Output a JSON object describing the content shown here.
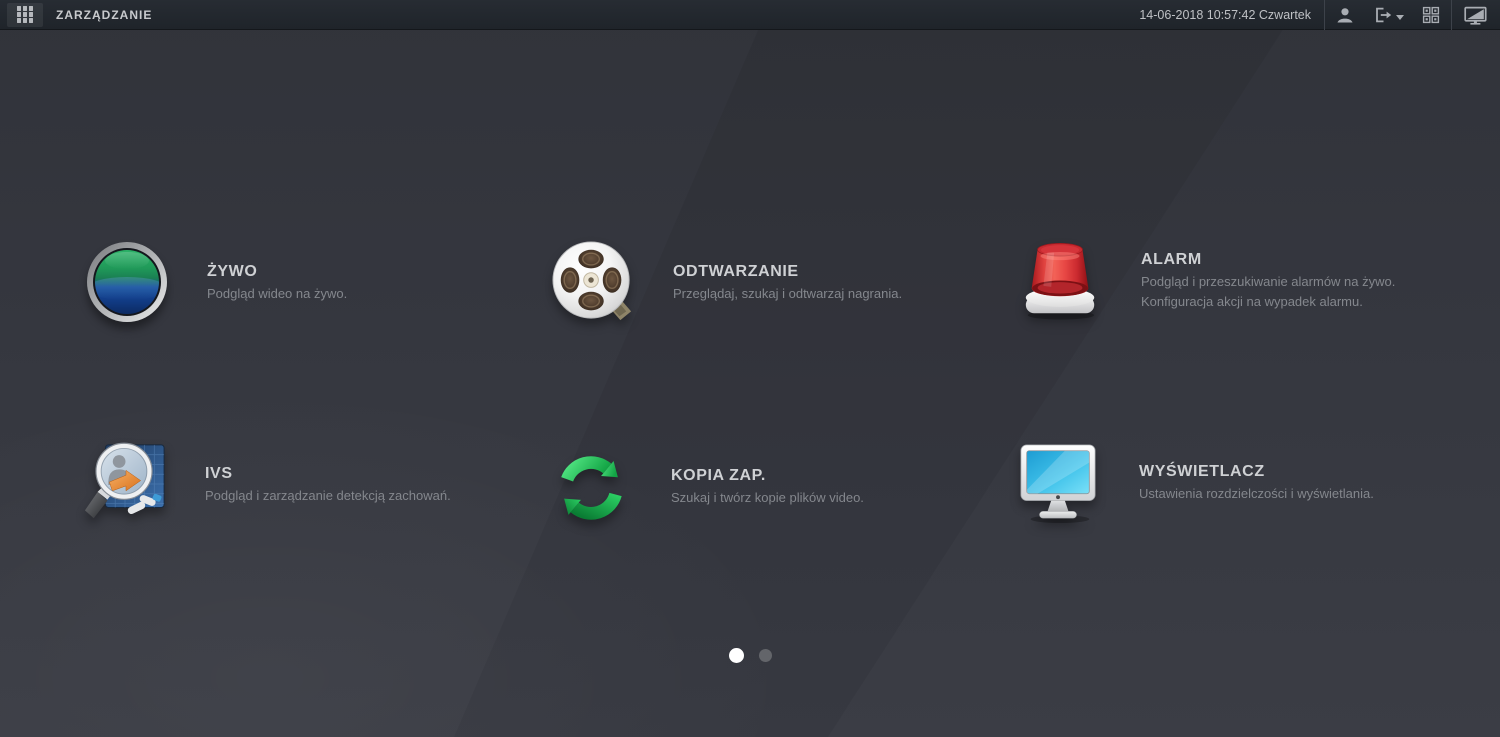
{
  "header": {
    "title": "ZARZĄDZANIE",
    "datetime": "14-06-2018 10:57:42 Czwartek",
    "icons": {
      "menu": "apps-grid-icon",
      "user": "user-icon",
      "logout": "logout-icon",
      "qr": "qr-code-icon",
      "display": "display-switch-icon"
    }
  },
  "tiles": [
    {
      "id": "zywo",
      "icon": "live-view-icon",
      "title": "ŻYWO",
      "desc": "Podgląd wideo na żywo."
    },
    {
      "id": "odtwarzanie",
      "icon": "playback-reel-icon",
      "title": "ODTWARZANIE",
      "desc": "Przeglądaj, szukaj i odtwarzaj nagrania."
    },
    {
      "id": "alarm",
      "icon": "alarm-siren-icon",
      "title": "ALARM",
      "desc": "Podgląd i przeszukiwanie alarmów na żywo.",
      "desc2": "Konfiguracja akcji na wypadek alarmu."
    },
    {
      "id": "ivs",
      "icon": "ivs-magnifier-icon",
      "title": "IVS",
      "desc": "Podgląd i zarządzanie detekcją zachowań."
    },
    {
      "id": "kopia-zap",
      "icon": "backup-sync-icon",
      "title": "KOPIA ZAP.",
      "desc": "Szukaj i twórz kopie plików video."
    },
    {
      "id": "wyswietlacz",
      "icon": "display-monitor-icon",
      "title": "WYŚWIETLACZ",
      "desc": "Ustawienia rozdzielczości i wyświetlania."
    }
  ],
  "pagination": {
    "total_pages": 2,
    "active_page": 1
  },
  "colors": {
    "topbar_bg": "#21262c",
    "background": "#35373f",
    "band_dark": "#30323a",
    "title_text": "#cfd1d4",
    "desc_text": "#84878d",
    "active_dot": "#ffffff",
    "inactive_dot": "#63656a",
    "alarm_red": "#e0423f",
    "backup_green": "#27c35c",
    "live_green": "#23a05c",
    "live_blue": "#164893",
    "screen_cyan": "#40c2ea",
    "ivs_blue": "#2f5d99"
  }
}
